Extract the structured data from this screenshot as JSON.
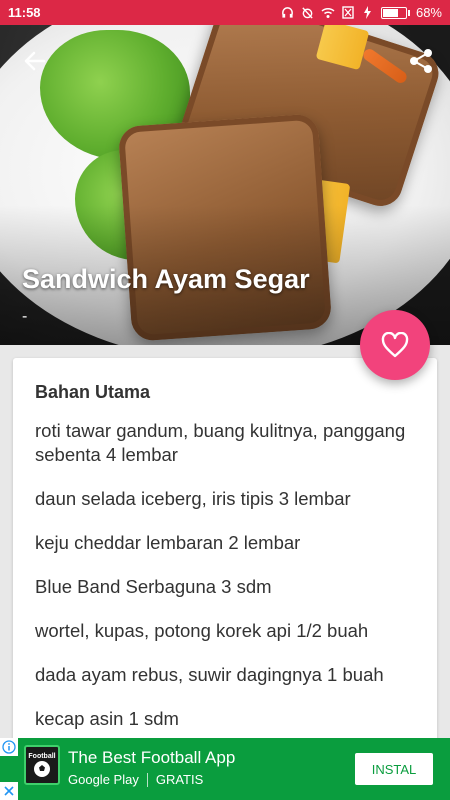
{
  "status_bar": {
    "time": "11:58",
    "battery_label": "68%",
    "battery_level": 0.68,
    "icons": [
      "headphones-icon",
      "alarm-off-icon",
      "wifi-icon",
      "sim-icon",
      "charging-icon",
      "battery-icon"
    ]
  },
  "colors": {
    "status_bar": "#dc2846",
    "fab": "#f2437c",
    "ad_background": "#0a9d3e"
  },
  "hero": {
    "title": "Sandwich Ayam Segar",
    "subtitle": "-",
    "back_icon": "arrow-back-icon",
    "share_icon": "share-icon",
    "favorite_icon": "heart-icon"
  },
  "ingredients": {
    "section_title": "Bahan Utama",
    "items": [
      "roti tawar gandum, buang kulitnya, panggang sebenta 4 lembar",
      "daun selada iceberg, iris tipis 3 lembar",
      "keju cheddar lembaran 2 lembar",
      "Blue Band Serbaguna 3 sdm",
      "wortel, kupas, potong korek api 1/2 buah",
      "dada ayam rebus, suwir dagingnya 1 buah",
      "kecap asin 1 sdm"
    ]
  },
  "ad": {
    "logo_text": "Football",
    "title": "The Best Football App",
    "store": "Google Play",
    "price": "GRATIS",
    "button": "INSTAL"
  }
}
